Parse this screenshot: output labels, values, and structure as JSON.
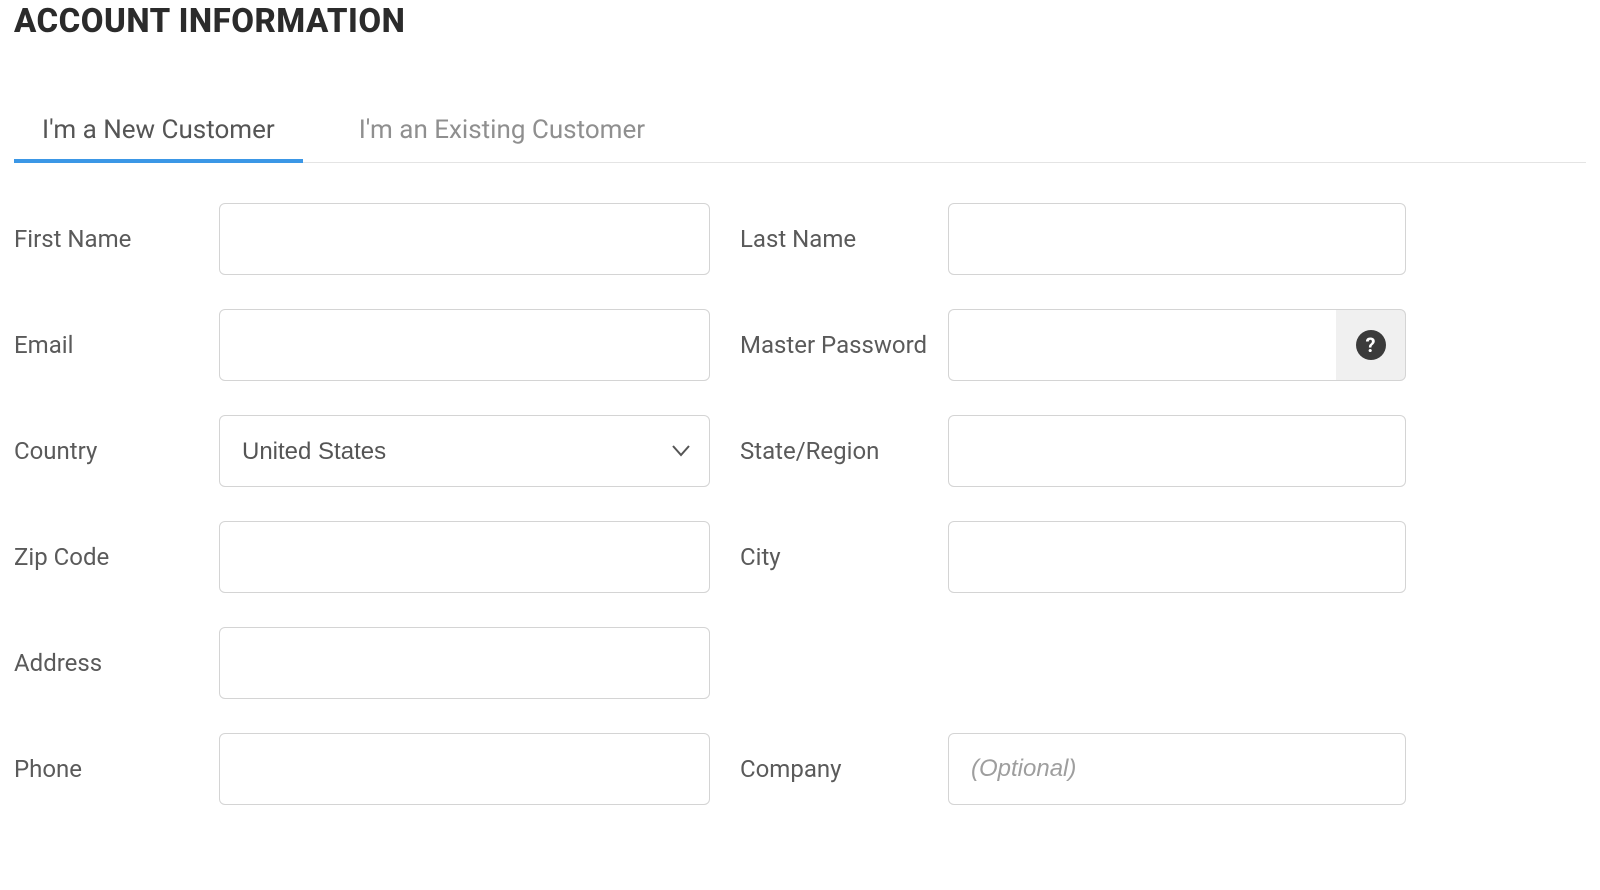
{
  "section_title": "ACCOUNT INFORMATION",
  "tabs": {
    "new_customer": "I'm a New Customer",
    "existing_customer": "I'm an Existing Customer",
    "active": "new_customer"
  },
  "fields": {
    "first_name": {
      "label": "First Name",
      "value": ""
    },
    "last_name": {
      "label": "Last Name",
      "value": ""
    },
    "email": {
      "label": "Email",
      "value": ""
    },
    "master_password": {
      "label": "Master Password",
      "value": ""
    },
    "country": {
      "label": "Country",
      "selected": "United States"
    },
    "state_region": {
      "label": "State/Region",
      "value": ""
    },
    "zip_code": {
      "label": "Zip Code",
      "value": ""
    },
    "city": {
      "label": "City",
      "value": ""
    },
    "address": {
      "label": "Address",
      "value": ""
    },
    "phone": {
      "label": "Phone",
      "value": ""
    },
    "company": {
      "label": "Company",
      "value": "",
      "placeholder": "(Optional)"
    }
  },
  "icons": {
    "help_glyph": "?"
  }
}
